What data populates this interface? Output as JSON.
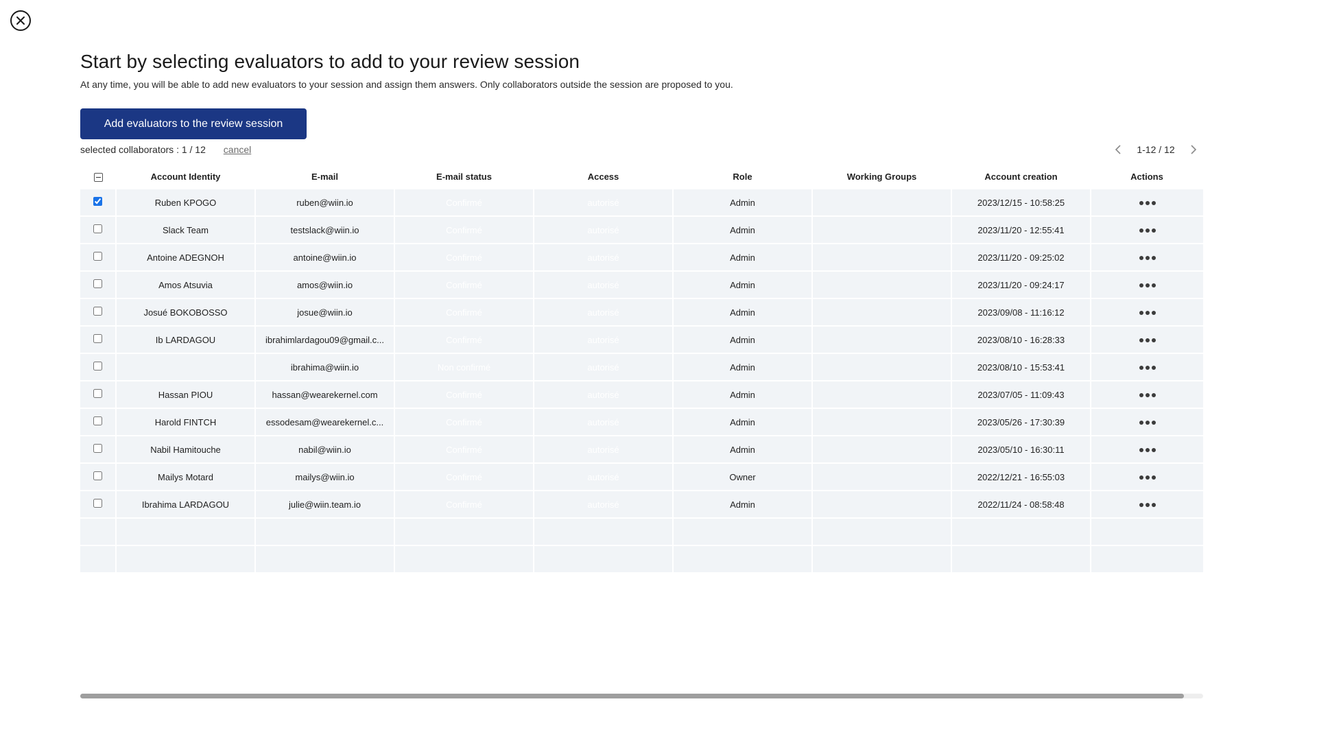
{
  "close": {
    "icon": "close-icon"
  },
  "header": {
    "title": "Start by selecting evaluators to add to your review session",
    "subtitle": "At any time, you will be able to add new evaluators to your session and assign them answers. Only collaborators outside the session are proposed to you."
  },
  "toolbar": {
    "add_label": "Add evaluators to the review session",
    "selected_label": "selected collaborators : 1 / 12",
    "cancel_label": "cancel"
  },
  "pagination": {
    "range": "1-12 / 12"
  },
  "table": {
    "columns": [
      "Account Identity",
      "E-mail",
      "E-mail status",
      "Access",
      "Role",
      "Working Groups",
      "Account creation",
      "Actions"
    ],
    "rows": [
      {
        "checked": true,
        "identity": "Ruben KPOGO",
        "email": "ruben@wiin.io",
        "status": "Confirmé",
        "access": "autorisé",
        "role": "Admin",
        "groups": "",
        "created": "2023/12/15 - 10:58:25"
      },
      {
        "checked": false,
        "identity": "Slack Team",
        "email": "testslack@wiin.io",
        "status": "Confirmé",
        "access": "autorisé",
        "role": "Admin",
        "groups": "",
        "created": "2023/11/20 - 12:55:41"
      },
      {
        "checked": false,
        "identity": "Antoine ADEGNOH",
        "email": "antoine@wiin.io",
        "status": "Confirmé",
        "access": "autorisé",
        "role": "Admin",
        "groups": "",
        "created": "2023/11/20 - 09:25:02"
      },
      {
        "checked": false,
        "identity": "Amos Atsuvia",
        "email": "amos@wiin.io",
        "status": "Confirmé",
        "access": "autorisé",
        "role": "Admin",
        "groups": "",
        "created": "2023/11/20 - 09:24:17"
      },
      {
        "checked": false,
        "identity": "Josué BOKOBOSSO",
        "email": "josue@wiin.io",
        "status": "Confirmé",
        "access": "autorisé",
        "role": "Admin",
        "groups": "",
        "created": "2023/09/08 - 11:16:12"
      },
      {
        "checked": false,
        "identity": "Ib LARDAGOU",
        "email": "ibrahimlardagou09@gmail.c...",
        "status": "Confirmé",
        "access": "autorisé",
        "role": "Admin",
        "groups": "",
        "created": "2023/08/10 - 16:28:33"
      },
      {
        "checked": false,
        "identity": "",
        "email": "ibrahima@wiin.io",
        "status": "Non confirmé",
        "access": "autorisé",
        "role": "Admin",
        "groups": "",
        "created": "2023/08/10 - 15:53:41"
      },
      {
        "checked": false,
        "identity": "Hassan PIOU",
        "email": "hassan@wearekernel.com",
        "status": "Confirmé",
        "access": "autorisé",
        "role": "Admin",
        "groups": "",
        "created": "2023/07/05 - 11:09:43"
      },
      {
        "checked": false,
        "identity": "Harold FINTCH",
        "email": "essodesam@wearekernel.c...",
        "status": "Confirmé",
        "access": "autorisé",
        "role": "Admin",
        "groups": "",
        "created": "2023/05/26 - 17:30:39"
      },
      {
        "checked": false,
        "identity": "Nabil Hamitouche",
        "email": "nabil@wiin.io",
        "status": "Confirmé",
        "access": "autorisé",
        "role": "Admin",
        "groups": "",
        "created": "2023/05/10 - 16:30:11"
      },
      {
        "checked": false,
        "identity": "Mailys Motard",
        "email": "mailys@wiin.io",
        "status": "Confirmé",
        "access": "autorisé",
        "role": "Owner",
        "groups": "",
        "created": "2022/12/21 - 16:55:03"
      },
      {
        "checked": false,
        "identity": "Ibrahima LARDAGOU",
        "email": "julie@wiin.team.io",
        "status": "Confirmé",
        "access": "autorisé",
        "role": "Admin",
        "groups": "",
        "created": "2022/11/24 - 08:58:48"
      }
    ]
  },
  "colors": {
    "primary_button": "#1b3784",
    "status_confirmed": "#27c26c",
    "status_unconfirmed": "#ec5424",
    "access_authorized": "#2e77f0",
    "row_background": "#f1f4f7"
  },
  "icons": {
    "prev": "chevron-left-icon",
    "next": "chevron-right-icon",
    "actions": "more-horizontal-icon"
  }
}
